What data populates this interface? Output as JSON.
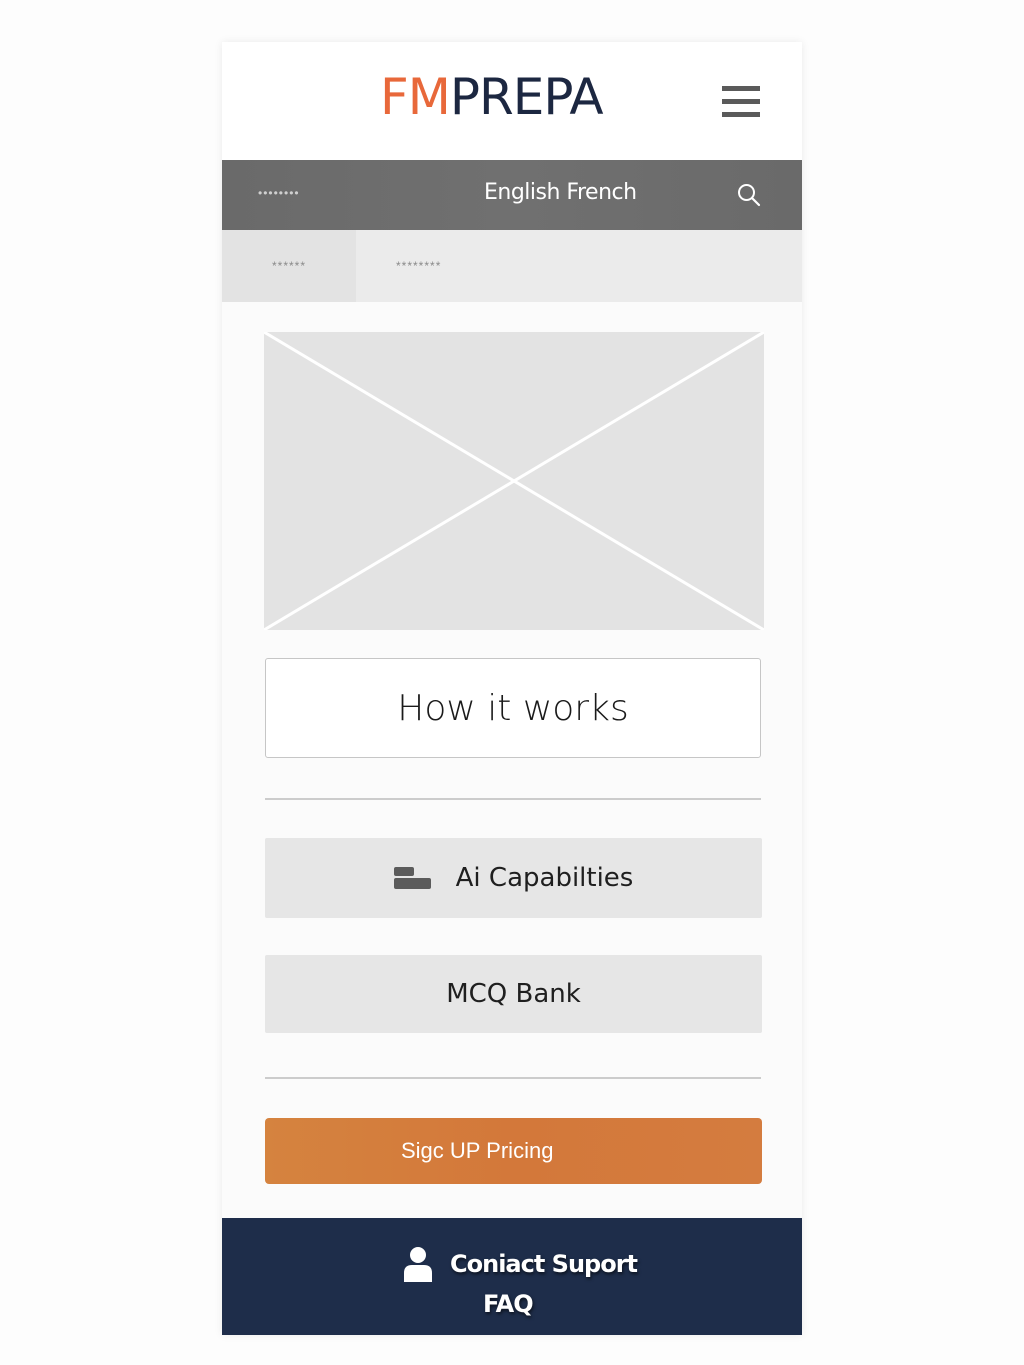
{
  "colors": {
    "brand_orange": "#e8683a",
    "brand_navy": "#1c2741",
    "topbar_grey": "#6d6d6d",
    "cta_orange": "#d47c3f",
    "footer_navy": "#1e2d4a"
  },
  "header": {
    "logo_part1": "FM",
    "logo_part2": "PREPA",
    "menu_icon": "hamburger-menu-icon"
  },
  "topbar": {
    "left_masked": "••••••••",
    "language_label": "English French",
    "search_icon": "search-icon"
  },
  "subnav": {
    "tabs": [
      {
        "label": "******"
      },
      {
        "label": "********"
      }
    ]
  },
  "hero": {
    "image_icon": "image-placeholder-icon"
  },
  "main": {
    "how_it_works_label": "How it works",
    "ai_capabilities_label": "Ai Capabilties",
    "ai_capabilities_icon": "feature-blocks-icon",
    "mcq_bank_label": "MCQ Bank",
    "cta_label": "Sigc UP Pricing"
  },
  "footer": {
    "contact_label": "Coniact Suport",
    "contact_icon": "user-icon",
    "faq_label": "FAQ"
  }
}
